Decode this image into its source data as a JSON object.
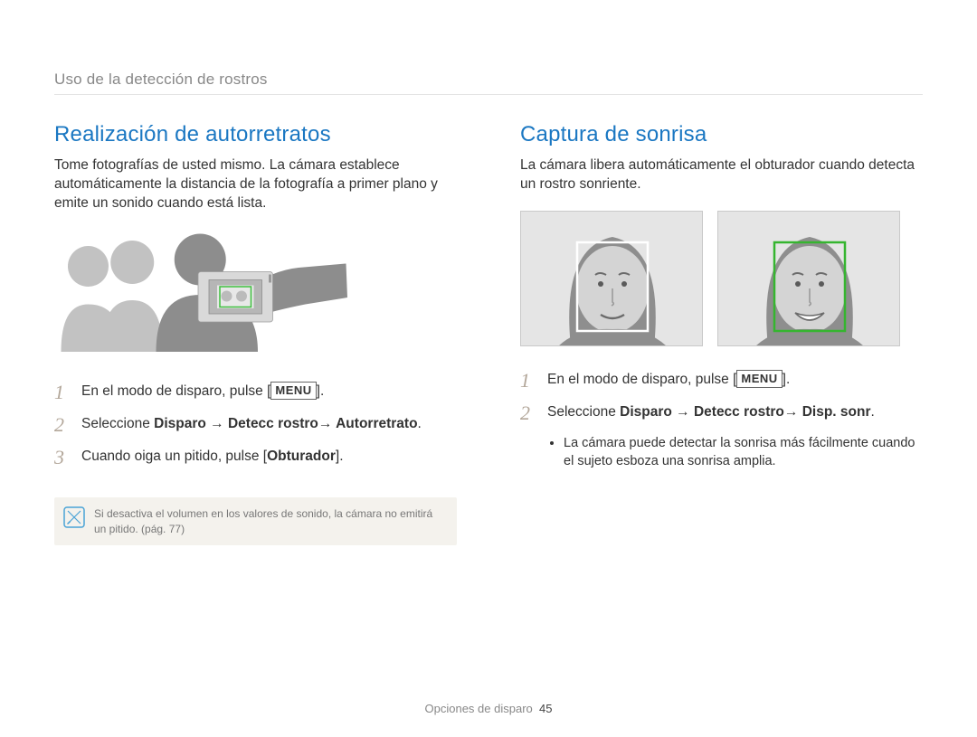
{
  "breadcrumb": "Uso de la detección de rostros",
  "left": {
    "title": "Realización de autorretratos",
    "intro": "Tome fotografías de usted mismo. La cámara establece automáticamente la distancia de la fotografía a primer plano y emite un sonido cuando está lista.",
    "steps": {
      "s1_pre": "En el modo de disparo, pulse [",
      "s1_menu": "MENU",
      "s1_post": "].",
      "s2_pre": "Seleccione ",
      "s2_bold": "Disparo → Detecc rostro→ Autorretrato",
      "s2_post": ".",
      "s3_pre": "Cuando oiga un pitido, pulse [",
      "s3_bold": "Obturador",
      "s3_post": "]."
    },
    "note": "Si desactiva el volumen en los valores de sonido, la cámara no emitirá un pitido. (pág. 77)"
  },
  "right": {
    "title": "Captura de sonrisa",
    "intro": "La cámara libera automáticamente el obturador cuando detecta un rostro sonriente.",
    "steps": {
      "s1_pre": "En el modo de disparo, pulse [",
      "s1_menu": "MENU",
      "s1_post": "].",
      "s2_pre": "Seleccione ",
      "s2_bold": "Disparo → Detecc rostro→ Disp. sonr",
      "s2_post": ".",
      "bullet": "La cámara puede detectar la sonrisa más fácilmente cuando el sujeto esboza una sonrisa amplia."
    }
  },
  "nums": {
    "one": "1",
    "two": "2",
    "three": "3"
  },
  "footer": {
    "section": "Opciones de disparo",
    "page": "45"
  },
  "icons": {
    "note": "note-icon"
  }
}
